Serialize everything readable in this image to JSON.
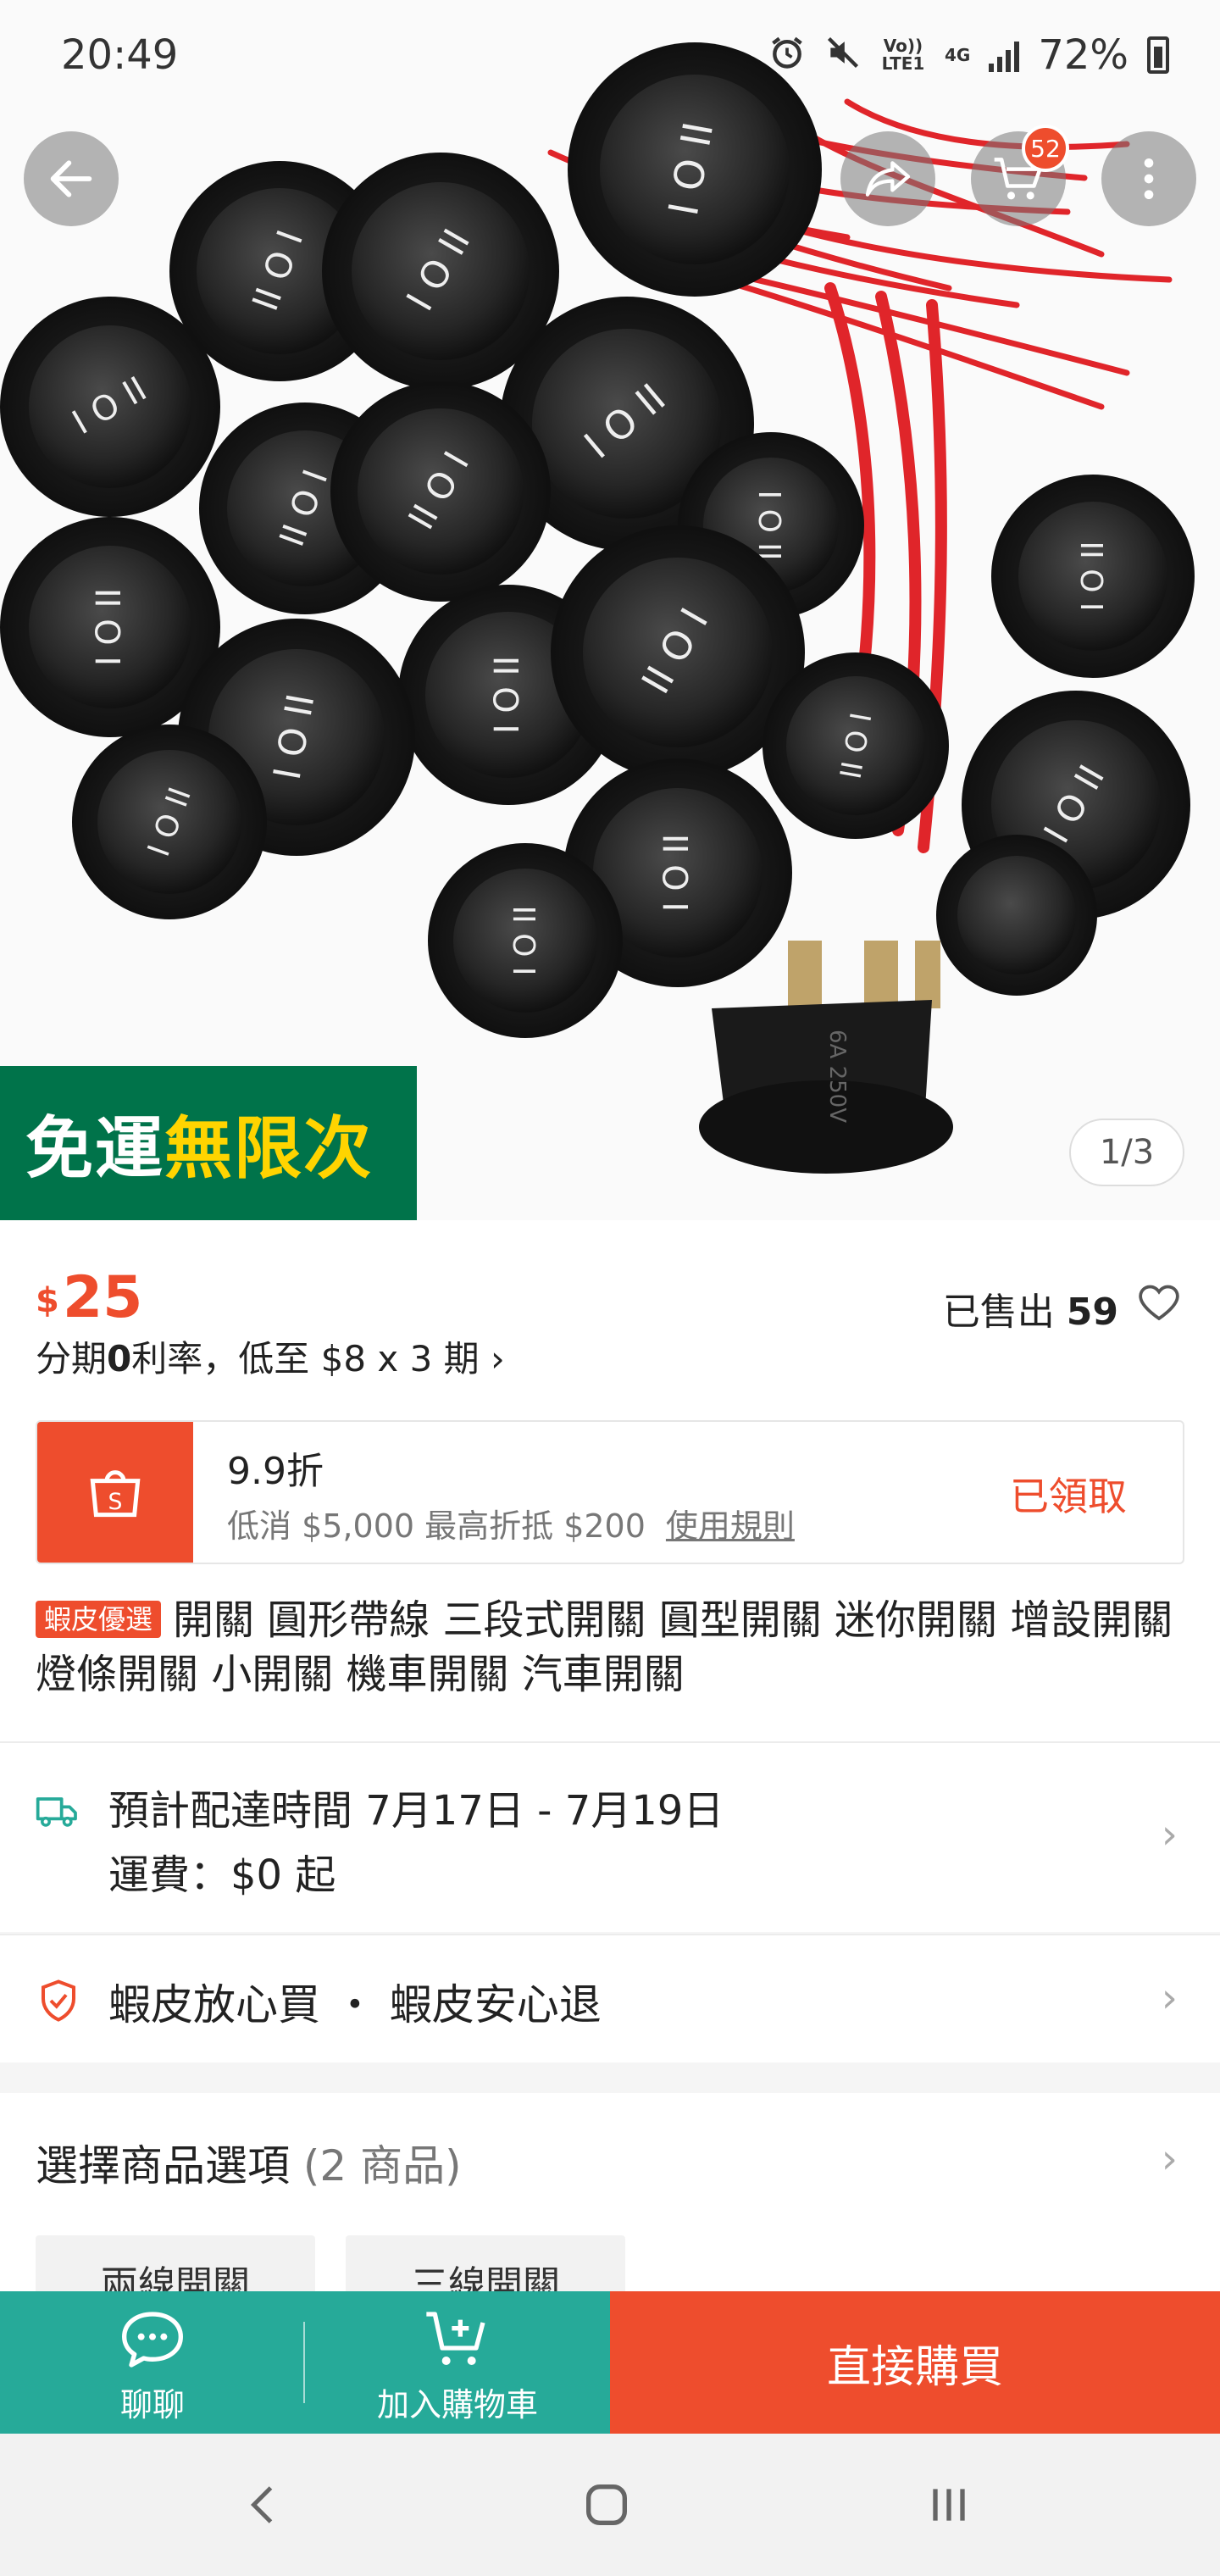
{
  "status_bar": {
    "time": "20:49",
    "network_volte": "Vo)) LTE1",
    "network_type": "4G",
    "battery": "72%",
    "icons": [
      "alarm-icon",
      "mute-icon",
      "signal-icon",
      "battery-charging-icon"
    ]
  },
  "header": {
    "back_icon": "back-arrow-icon",
    "share_icon": "share-icon",
    "cart_icon": "cart-icon",
    "cart_badge": "52",
    "more_icon": "more-vertical-icon"
  },
  "gallery": {
    "promo_part1": "免運",
    "promo_part2": "無限次",
    "counter": "1/3",
    "colors": {
      "promo_bg": "#00734a",
      "promo_highlight": "#ffd400"
    }
  },
  "product": {
    "currency": "$",
    "price": "25",
    "sold_label": "已售出",
    "sold_count": "59",
    "installment_prefix": "分期",
    "installment_rate": "0",
    "installment_suffix": "利率，低至 $8 x 3 期 ›",
    "tag": "蝦皮優選",
    "title": "開關 圓形帶線 三段式開關 圓型開關 迷你開關 增設開關 燈條開關 小開關 機車開關 汽車開關"
  },
  "voucher": {
    "icon": "shopee-bag-icon",
    "title": "9.9折",
    "description": "低消 $5,000 最高折抵 $200",
    "rule_link": "使用規則",
    "status": "已領取"
  },
  "shipping": {
    "icon": "truck-icon",
    "estimate": "預計配達時間 7月17日 - 7月19日",
    "fee": "運費：$0 起"
  },
  "guarantee": {
    "icon": "shield-check-icon",
    "text": "蝦皮放心買 ・ 蝦皮安心退"
  },
  "options": {
    "title": "選擇商品選項",
    "count": "(2 商品)",
    "items": [
      "兩線開關",
      "三線開關"
    ]
  },
  "bottom_bar": {
    "chat_label": "聊聊",
    "add_cart_label": "加入購物車",
    "buy_now_label": "直接購買"
  },
  "theme": {
    "accent": "#ee4d2d",
    "secondary": "#26aa99"
  }
}
